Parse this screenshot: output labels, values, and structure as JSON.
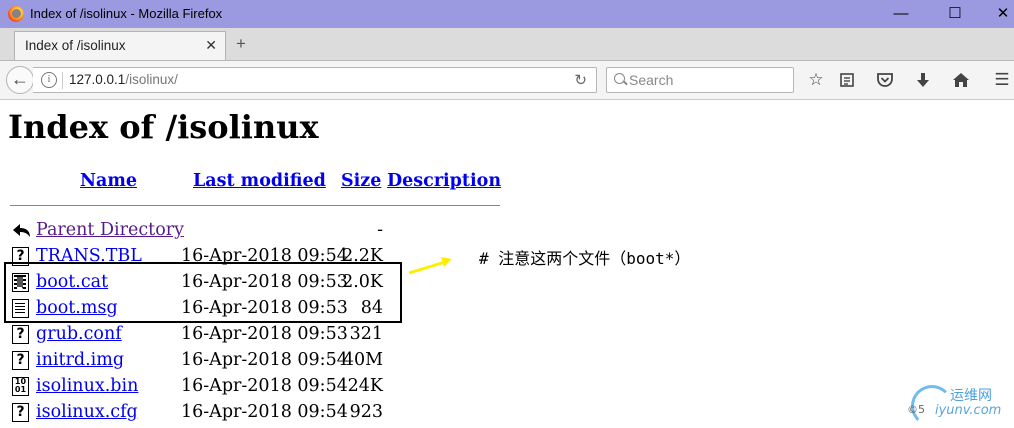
{
  "window": {
    "title": "Index of /isolinux - Mozilla Firefox",
    "minimize_glyph": "—",
    "maximize_glyph": "☐",
    "close_glyph": "✕"
  },
  "tabs": [
    {
      "label": "Index of /isolinux",
      "close_glyph": "✕"
    }
  ],
  "newtab_glyph": "+",
  "navbar": {
    "url_host": "127.0.0.1",
    "url_path": "/isolinux/",
    "search_placeholder": "Search",
    "icons": [
      "back-icon",
      "info-icon",
      "reload-icon",
      "search-icon",
      "bookmark-star-icon",
      "reading-list-icon",
      "pocket-icon",
      "download-icon",
      "home-icon",
      "menu-icon"
    ]
  },
  "page": {
    "heading": "Index of /isolinux",
    "columns": {
      "name": "Name",
      "last_modified": "Last modified",
      "size": "Size",
      "description": "Description"
    },
    "parent": {
      "name": "Parent Directory",
      "size": "-"
    },
    "files": [
      {
        "name": "TRANS.TBL",
        "date": "16-Apr-2018 09:54",
        "size": "2.2K",
        "icon": "unknown-file-icon"
      },
      {
        "name": "boot.cat",
        "date": "16-Apr-2018 09:53",
        "size": "2.0K",
        "icon": "binary-film-icon"
      },
      {
        "name": "boot.msg",
        "date": "16-Apr-2018 09:53",
        "size": "84",
        "icon": "text-file-icon"
      },
      {
        "name": "grub.conf",
        "date": "16-Apr-2018 09:53",
        "size": "321",
        "icon": "unknown-file-icon"
      },
      {
        "name": "initrd.img",
        "date": "16-Apr-2018 09:54",
        "size": "40M",
        "icon": "unknown-file-icon"
      },
      {
        "name": "isolinux.bin",
        "date": "16-Apr-2018 09:54",
        "size": "24K",
        "icon": "binary-file-icon"
      },
      {
        "name": "isolinux.cfg",
        "date": "16-Apr-2018 09:54",
        "size": "923",
        "icon": "unknown-file-icon"
      }
    ],
    "annotation": "# 注意这两个文件（boot*）",
    "annotation_arrow_color": "#ffee00"
  },
  "watermark": {
    "cn": "运维网",
    "en": "iyunv.com",
    "copyright": "©5"
  },
  "colors": {
    "titlebar": "#9b9ae0",
    "link": "#0000ee",
    "visited_link": "#551a8b"
  }
}
